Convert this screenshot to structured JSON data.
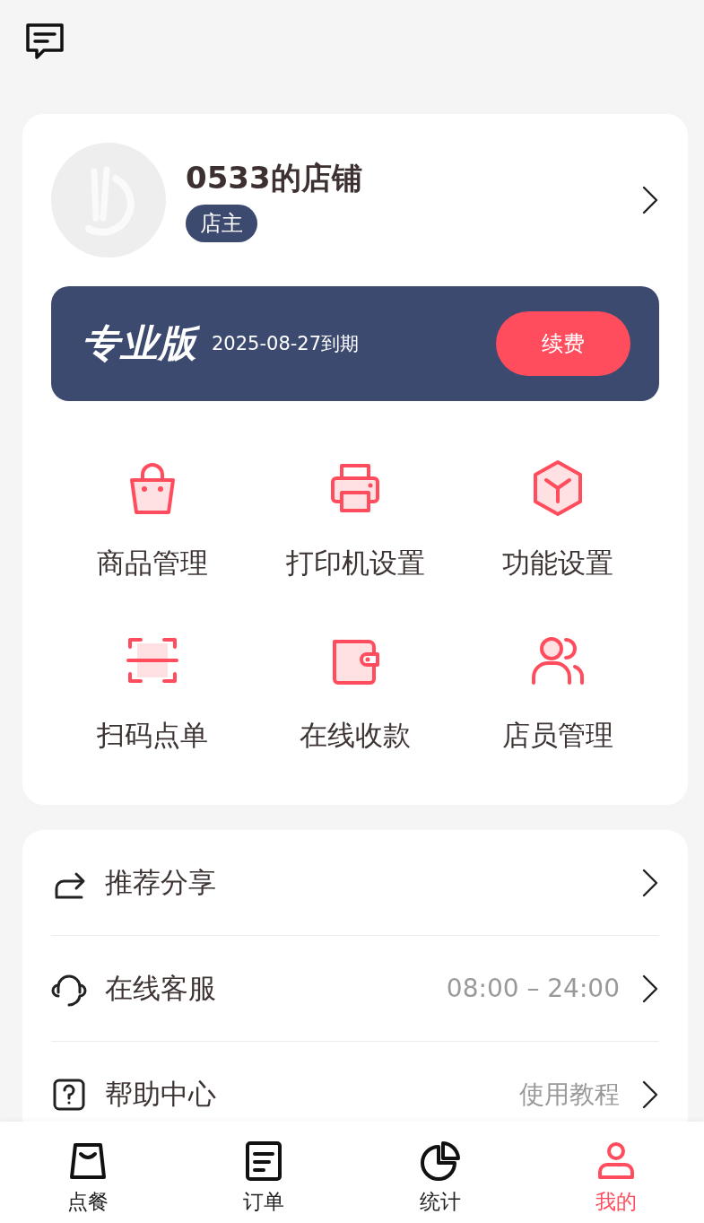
{
  "shop": {
    "name": "0533的店铺",
    "role": "店主"
  },
  "plan": {
    "name": "专业版",
    "expiry": "2025-08-27到期",
    "button": "续费"
  },
  "features": [
    {
      "label": "商品管理"
    },
    {
      "label": "打印机设置"
    },
    {
      "label": "功能设置"
    },
    {
      "label": "扫码点单"
    },
    {
      "label": "在线收款"
    },
    {
      "label": "店员管理"
    }
  ],
  "menu": [
    {
      "label": "推荐分享"
    },
    {
      "label": "在线客服",
      "detail": "08:00 – 24:00"
    },
    {
      "label": "帮助中心",
      "detail": "使用教程"
    }
  ],
  "tabs": [
    {
      "label": "点餐",
      "selected": false
    },
    {
      "label": "订单",
      "selected": false
    },
    {
      "label": "统计",
      "selected": false
    },
    {
      "label": "我的",
      "selected": true
    }
  ]
}
